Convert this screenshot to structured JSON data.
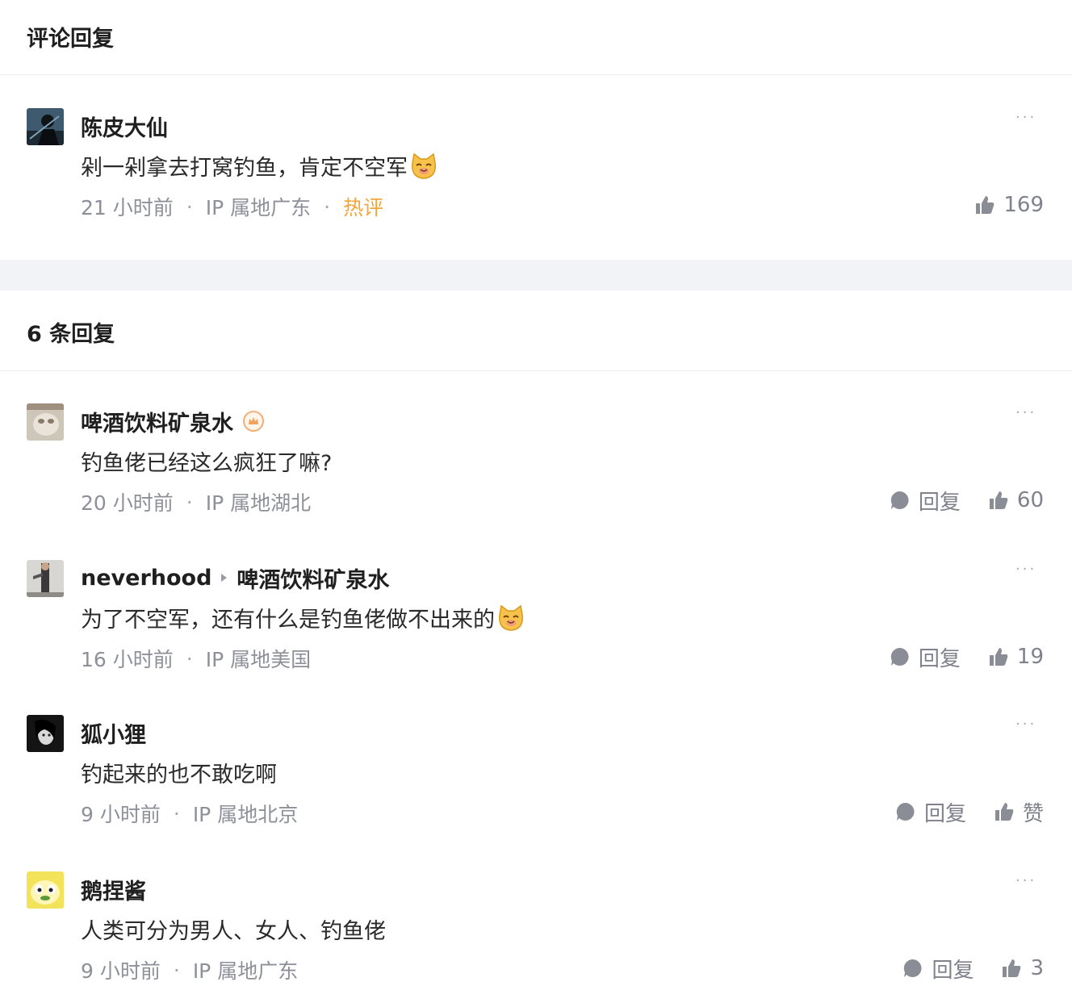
{
  "header": {
    "title": "评论回复"
  },
  "main_comment": {
    "user": "陈皮大仙",
    "text": "剁一剁拿去打窝钓鱼，肯定不空军",
    "emoji": "cat-face-icon",
    "time": "21 小时前",
    "ip": "IP 属地广东",
    "tag": "热评",
    "likes": "169"
  },
  "replies_header": {
    "title": "6 条回复"
  },
  "replies": [
    {
      "user": "啤酒饮料矿泉水",
      "badge": "crown-badge-icon",
      "text": "钓鱼佬已经这么疯狂了嘛?",
      "time": "20 小时前",
      "ip": "IP 属地湖北",
      "reply_label": "回复",
      "likes": "60"
    },
    {
      "user": "neverhood",
      "reply_to": "啤酒饮料矿泉水",
      "text": "为了不空军，还有什么是钓鱼佬做不出来的",
      "emoji": "cat-face-icon",
      "time": "16 小时前",
      "ip": "IP 属地美国",
      "reply_label": "回复",
      "likes": "19"
    },
    {
      "user": "狐小狸",
      "text": "钓起来的也不敢吃啊",
      "time": "9 小时前",
      "ip": "IP 属地北京",
      "reply_label": "回复",
      "likes": "赞"
    },
    {
      "user": "鹅捏酱",
      "text": "人类可分为男人、女人、钓鱼佬",
      "time": "9 小时前",
      "ip": "IP 属地广东",
      "reply_label": "回复",
      "likes": "3"
    }
  ],
  "more_label": "···",
  "separator": "·",
  "colors": {
    "hot": "#f3a63a",
    "meta": "#8d9099",
    "band": "#f2f3f6"
  }
}
